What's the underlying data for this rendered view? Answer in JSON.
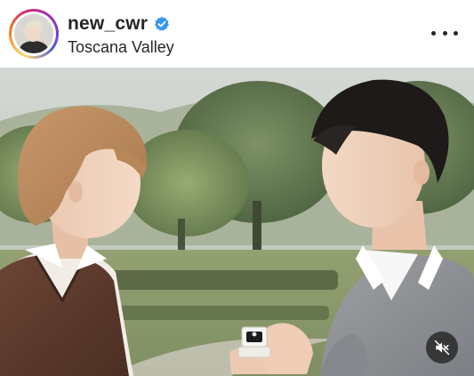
{
  "post": {
    "username": "new_cwr",
    "location": "Toscana Valley",
    "verified": true,
    "avatar_icon": "profile-avatar",
    "more_icon": "more-horizontal-icon",
    "audio_state": "muted",
    "mute_icon": "speaker-muted-icon"
  },
  "colors": {
    "story_ring": [
      "#feda75",
      "#fa7e1e",
      "#d62976",
      "#962fbf",
      "#4f5bd5"
    ],
    "verified_badge": "#3897f0",
    "text": "#262626"
  }
}
